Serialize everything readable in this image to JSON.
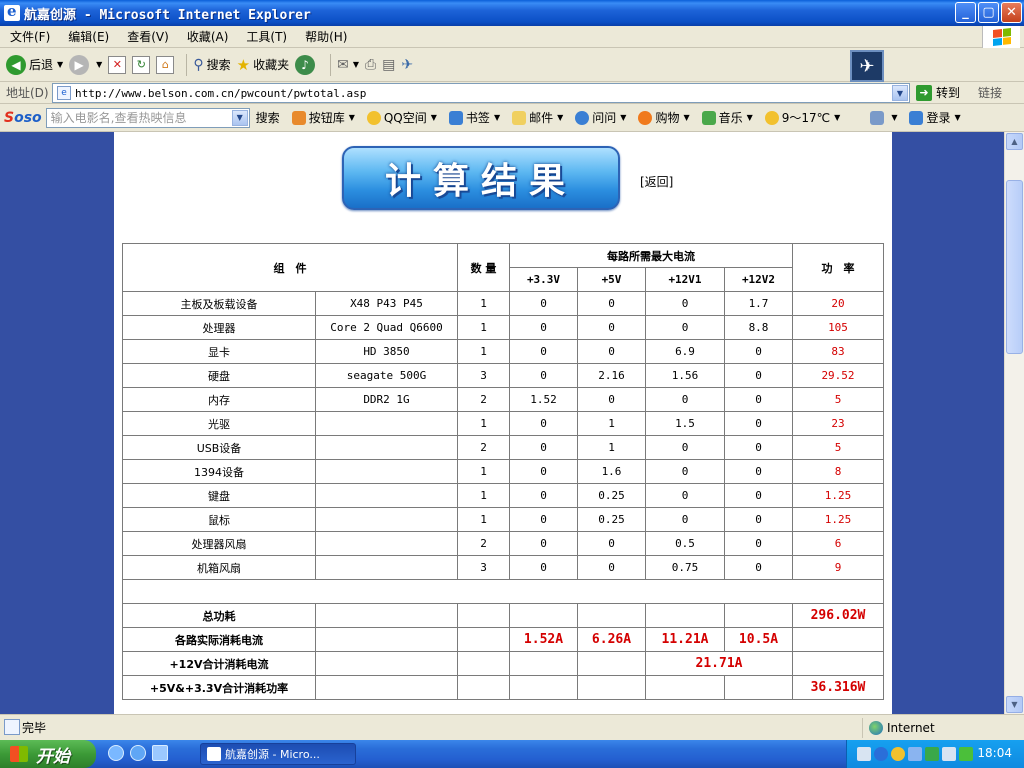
{
  "window": {
    "title": "航嘉创源 - Microsoft Internet Explorer",
    "min": "_",
    "max": "▢",
    "close": "✕"
  },
  "menu": [
    "文件(F)",
    "编辑(E)",
    "查看(V)",
    "收藏(A)",
    "工具(T)",
    "帮助(H)"
  ],
  "toolbar": {
    "back": "后退",
    "search": "搜索",
    "favorites": "收藏夹"
  },
  "address": {
    "label": "地址(D)",
    "url": "http://www.belson.com.cn/pwcount/pwtotal.asp",
    "go": "转到",
    "links": "链接"
  },
  "soso": {
    "logo_s": "S",
    "logo_rest": "oso",
    "placeholder": "输入电影名,查看热映信息",
    "search": "搜索",
    "items": [
      "按钮库",
      "QQ空间",
      "书签",
      "邮件",
      "问问",
      "购物",
      "音乐",
      "9～17℃"
    ],
    "login": "登录"
  },
  "page": {
    "banner": "计算结果",
    "back": "[返回]",
    "headers": {
      "component": "组　件",
      "quantity": "数 量",
      "current_group": "每路所需最大电流",
      "v33": "+3.3V",
      "v5": "+5V",
      "v12_1": "+12V1",
      "v12_2": "+12V2",
      "power": "功　率"
    },
    "rows": [
      [
        "主板及板载设备",
        "X48 P43 P45",
        "1",
        "0",
        "0",
        "0",
        "1.7",
        "20"
      ],
      [
        "处理器",
        "Core 2 Quad Q6600",
        "1",
        "0",
        "0",
        "0",
        "8.8",
        "105"
      ],
      [
        "显卡",
        "HD 3850",
        "1",
        "0",
        "0",
        "6.9",
        "0",
        "83"
      ],
      [
        "硬盘",
        "seagate 500G",
        "3",
        "0",
        "2.16",
        "1.56",
        "0",
        "29.52"
      ],
      [
        "内存",
        "DDR2 1G",
        "2",
        "1.52",
        "0",
        "0",
        "0",
        "5"
      ],
      [
        "光驱",
        "",
        "1",
        "0",
        "1",
        "1.5",
        "0",
        "23"
      ],
      [
        "USB设备",
        "",
        "2",
        "0",
        "1",
        "0",
        "0",
        "5"
      ],
      [
        "1394设备",
        "",
        "1",
        "0",
        "1.6",
        "0",
        "0",
        "8"
      ],
      [
        "键盘",
        "",
        "1",
        "0",
        "0.25",
        "0",
        "0",
        "1.25"
      ],
      [
        "鼠标",
        "",
        "1",
        "0",
        "0.25",
        "0",
        "0",
        "1.25"
      ],
      [
        "处理器风扇",
        "",
        "2",
        "0",
        "0",
        "0.5",
        "0",
        "6"
      ],
      [
        "机箱风扇",
        "",
        "3",
        "0",
        "0",
        "0.75",
        "0",
        "9"
      ]
    ],
    "summary": {
      "total_label": "总功耗",
      "total_value": "296.02W",
      "actual_label": "各路实际消耗电流",
      "actual_values": [
        "1.52A",
        "6.26A",
        "11.21A",
        "10.5A"
      ],
      "p12_label": "+12V合计消耗电流",
      "p12_value": "21.71A",
      "p5_label": "+5V&+3.3V合计消耗功率",
      "p5_value": "36.316W"
    }
  },
  "status": {
    "done": "完毕",
    "zone": "Internet"
  },
  "taskbar": {
    "start": "开始",
    "task": "航嘉创源 - Micro...",
    "clock": "18:04"
  }
}
